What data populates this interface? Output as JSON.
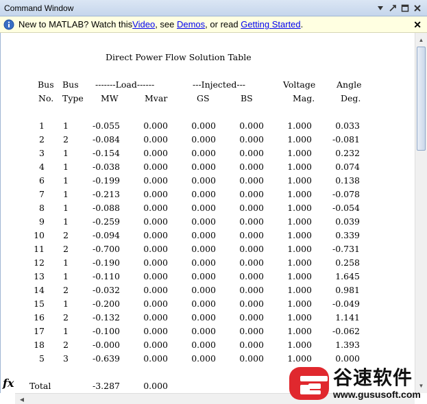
{
  "window": {
    "title": "Command Window"
  },
  "infobar": {
    "prefix": "New to MATLAB? Watch this ",
    "link_video": "Video",
    "sep1": ", see ",
    "link_demos": "Demos",
    "sep2": ", or read ",
    "link_started": "Getting Started",
    "suffix": "."
  },
  "table": {
    "title": "Direct Power Flow Solution Table",
    "header1": [
      "Bus",
      "Bus",
      "-------Load------",
      "---Injected---",
      "Voltage",
      "Angle"
    ],
    "header2": [
      "No.",
      "Type",
      "MW",
      "Mvar",
      "GS",
      "BS",
      "Mag.",
      "Deg."
    ],
    "rows": [
      [
        "1",
        "1",
        "-0.055",
        "0.000",
        "0.000",
        "0.000",
        "1.000",
        "0.033"
      ],
      [
        "2",
        "2",
        "-0.084",
        "0.000",
        "0.000",
        "0.000",
        "1.000",
        "-0.081"
      ],
      [
        "3",
        "1",
        "-0.154",
        "0.000",
        "0.000",
        "0.000",
        "1.000",
        "0.232"
      ],
      [
        "4",
        "1",
        "-0.038",
        "0.000",
        "0.000",
        "0.000",
        "1.000",
        "0.074"
      ],
      [
        "6",
        "1",
        "-0.199",
        "0.000",
        "0.000",
        "0.000",
        "1.000",
        "0.138"
      ],
      [
        "7",
        "1",
        "-0.213",
        "0.000",
        "0.000",
        "0.000",
        "1.000",
        "-0.078"
      ],
      [
        "8",
        "1",
        "-0.088",
        "0.000",
        "0.000",
        "0.000",
        "1.000",
        "-0.054"
      ],
      [
        "9",
        "1",
        "-0.259",
        "0.000",
        "0.000",
        "0.000",
        "1.000",
        "0.039"
      ],
      [
        "10",
        "2",
        "-0.094",
        "0.000",
        "0.000",
        "0.000",
        "1.000",
        "0.339"
      ],
      [
        "11",
        "2",
        "-0.700",
        "0.000",
        "0.000",
        "0.000",
        "1.000",
        "-0.731"
      ],
      [
        "12",
        "1",
        "-0.190",
        "0.000",
        "0.000",
        "0.000",
        "1.000",
        "0.258"
      ],
      [
        "13",
        "1",
        "-0.110",
        "0.000",
        "0.000",
        "0.000",
        "1.000",
        "1.645"
      ],
      [
        "14",
        "2",
        "-0.032",
        "0.000",
        "0.000",
        "0.000",
        "1.000",
        "0.981"
      ],
      [
        "15",
        "1",
        "-0.200",
        "0.000",
        "0.000",
        "0.000",
        "1.000",
        "-0.049"
      ],
      [
        "16",
        "2",
        "-0.132",
        "0.000",
        "0.000",
        "0.000",
        "1.000",
        "1.141"
      ],
      [
        "17",
        "1",
        "-0.100",
        "0.000",
        "0.000",
        "0.000",
        "1.000",
        "-0.062"
      ],
      [
        "18",
        "2",
        "-0.000",
        "0.000",
        "0.000",
        "0.000",
        "1.000",
        "1.393"
      ],
      [
        "5",
        "3",
        "-0.639",
        "0.000",
        "0.000",
        "0.000",
        "1.000",
        "0.000"
      ]
    ],
    "total_label": "Total",
    "total_mw": "-3.287",
    "total_mvar": "0.000"
  },
  "prompt": {
    "fx_label": "fx"
  },
  "watermark": {
    "name": "谷速软件",
    "url": "www.gususoft.com",
    "accent": "#e0282e"
  }
}
